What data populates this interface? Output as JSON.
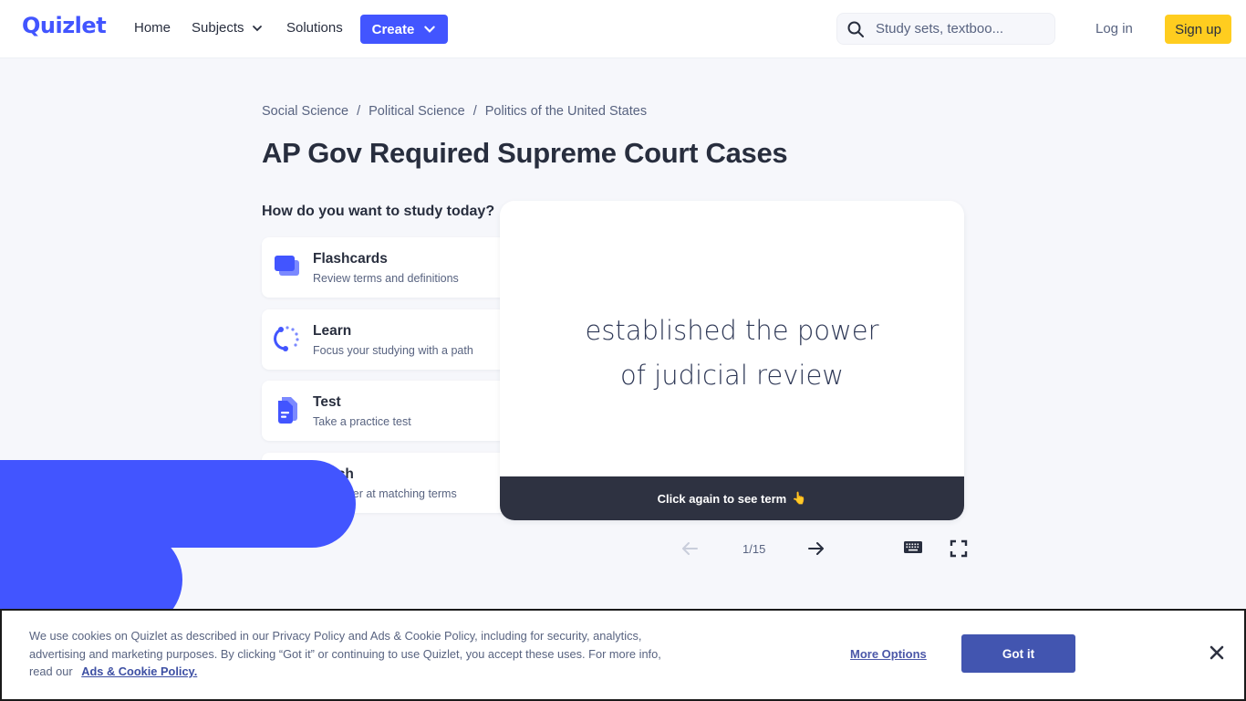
{
  "header": {
    "logo": "Quizlet",
    "nav": {
      "home": "Home",
      "subjects": "Subjects",
      "solutions": "Solutions",
      "create": "Create"
    },
    "search_placeholder": "Study sets, textboo...",
    "login": "Log in",
    "signup": "Sign up"
  },
  "breadcrumb": [
    "Social Science",
    "Political Science",
    "Politics of the United States"
  ],
  "breadcrumb_separator": "/",
  "title": "AP Gov Required Supreme Court Cases",
  "study_prompt": "How do you want to study today?",
  "modes": [
    {
      "title": "Flashcards",
      "subtitle": "Review terms and definitions",
      "icon": "flashcards-icon"
    },
    {
      "title": "Learn",
      "subtitle": "Focus your studying with a path",
      "icon": "learn-icon"
    },
    {
      "title": "Test",
      "subtitle": "Take a practice test",
      "icon": "test-icon"
    },
    {
      "title": "Match",
      "subtitle": "Get faster at matching terms",
      "icon": "match-icon"
    }
  ],
  "flashcard": {
    "text": "established the power of judicial review",
    "footer": "Click again to see term",
    "footer_emoji": "👆"
  },
  "controls": {
    "counter": "1/15",
    "current": 1,
    "total": 15
  },
  "cookie_banner": {
    "text": "We use cookies on Quizlet as described in our Privacy Policy and Ads & Cookie Policy, including for security, analytics, advertising and marketing purposes. By clicking “Got it” or continuing to use Quizlet, you accept these uses. For more info, read our",
    "link": "Ads & Cookie Policy.",
    "more_options": "More Options",
    "got_it": "Got it"
  },
  "colors": {
    "brand": "#4255ff",
    "signup": "#ffcd1f",
    "card_footer": "#2e3241",
    "got_it": "#4255b0"
  }
}
